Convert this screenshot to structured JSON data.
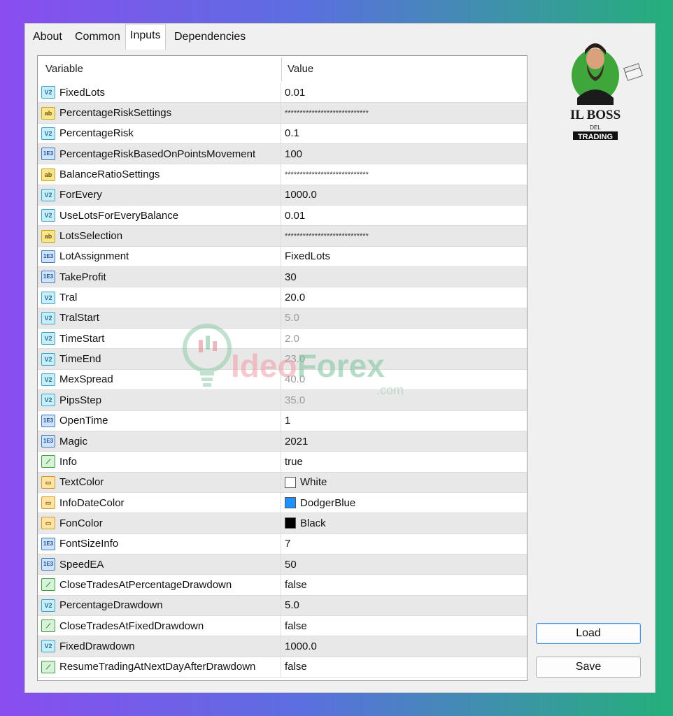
{
  "tabs": [
    {
      "label": "About"
    },
    {
      "label": "Common"
    },
    {
      "label": "Inputs"
    },
    {
      "label": "Dependencies"
    }
  ],
  "active_tab": "Inputs",
  "table": {
    "col_variable": "Variable",
    "col_value": "Value",
    "rows": [
      {
        "icon": "double-type-icon",
        "name": "FixedLots",
        "value": "0.01"
      },
      {
        "icon": "string-type-icon",
        "name": "PercentageRiskSettings",
        "value": "****************************"
      },
      {
        "icon": "double-type-icon",
        "name": "PercentageRisk",
        "value": "0.1"
      },
      {
        "icon": "integer-type-icon",
        "name": "PercentageRiskBasedOnPointsMovement",
        "value": "100"
      },
      {
        "icon": "string-type-icon",
        "name": "BalanceRatioSettings",
        "value": "****************************"
      },
      {
        "icon": "double-type-icon",
        "name": "ForEvery",
        "value": "1000.0"
      },
      {
        "icon": "double-type-icon",
        "name": "UseLotsForEveryBalance",
        "value": "0.01"
      },
      {
        "icon": "string-type-icon",
        "name": "LotsSelection",
        "value": "****************************"
      },
      {
        "icon": "integer-type-icon",
        "name": "LotAssignment",
        "value": "FixedLots"
      },
      {
        "icon": "integer-type-icon",
        "name": "TakeProfit",
        "value": "30"
      },
      {
        "icon": "double-type-icon",
        "name": "Tral",
        "value": "20.0"
      },
      {
        "icon": "double-type-icon",
        "name": "TralStart",
        "value": "5.0"
      },
      {
        "icon": "double-type-icon",
        "name": "TimeStart",
        "value": "2.0"
      },
      {
        "icon": "double-type-icon",
        "name": "TimeEnd",
        "value": "23.0"
      },
      {
        "icon": "double-type-icon",
        "name": "MexSpread",
        "value": "40.0"
      },
      {
        "icon": "double-type-icon",
        "name": "PipsStep",
        "value": "35.0"
      },
      {
        "icon": "integer-type-icon",
        "name": "OpenTime",
        "value": "1"
      },
      {
        "icon": "integer-type-icon",
        "name": "Magic",
        "value": "2021"
      },
      {
        "icon": "bool-type-icon",
        "name": "Info",
        "value": "true"
      },
      {
        "icon": "color-type-icon",
        "name": "TextColor",
        "value": "White",
        "swatch": "#ffffff"
      },
      {
        "icon": "color-type-icon",
        "name": "InfoDateColor",
        "value": "DodgerBlue",
        "swatch": "#1e90ff"
      },
      {
        "icon": "color-type-icon",
        "name": "FonColor",
        "value": "Black",
        "swatch": "#000000"
      },
      {
        "icon": "integer-type-icon",
        "name": "FontSizeInfo",
        "value": "7"
      },
      {
        "icon": "integer-type-icon",
        "name": "SpeedEA",
        "value": "50"
      },
      {
        "icon": "bool-type-icon",
        "name": "CloseTradesAtPercentageDrawdown",
        "value": "false"
      },
      {
        "icon": "double-type-icon",
        "name": "PercentageDrawdown",
        "value": "5.0"
      },
      {
        "icon": "bool-type-icon",
        "name": "CloseTradesAtFixedDrawdown",
        "value": "false"
      },
      {
        "icon": "double-type-icon",
        "name": "FixedDrawdown",
        "value": "1000.0"
      },
      {
        "icon": "bool-type-icon",
        "name": "ResumeTradingAtNextDayAfterDrawdown",
        "value": "false"
      }
    ]
  },
  "buttons": {
    "load": "Load",
    "save": "Save"
  },
  "logo": {
    "line1": "IL BOSS",
    "line2": "DEL",
    "line3": "TRADING"
  },
  "watermark": {
    "text_ideo": "Ideo",
    "text_forex": "Forex",
    "text_com": ".com"
  }
}
